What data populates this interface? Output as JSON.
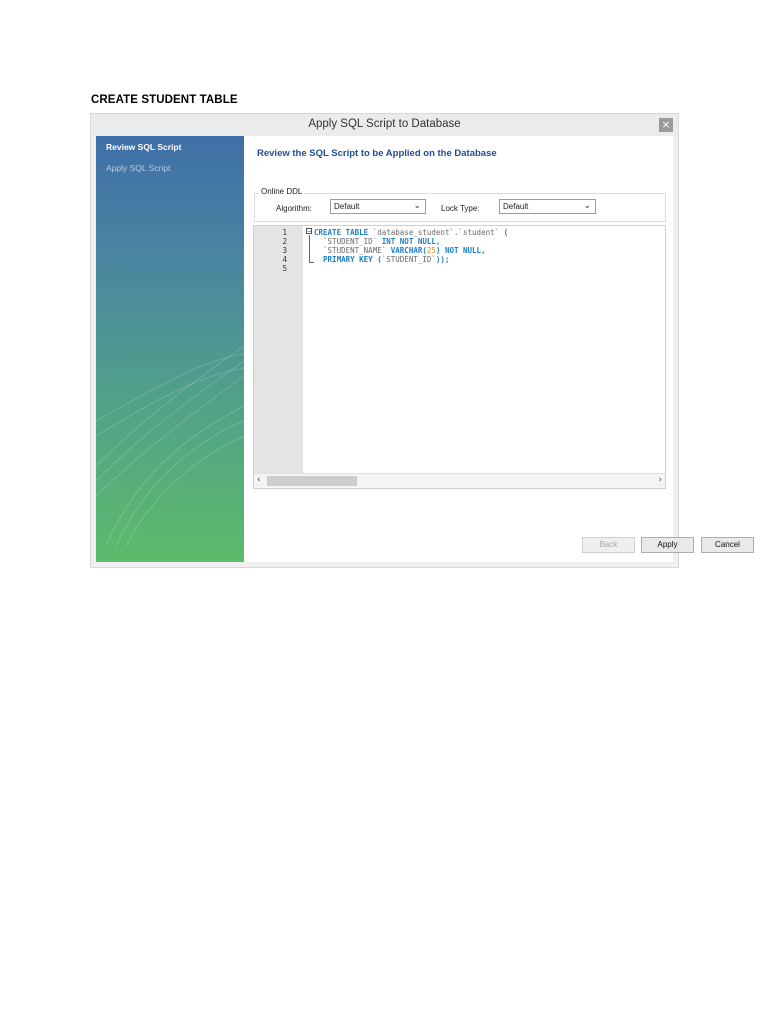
{
  "document": {
    "heading": "CREATE STUDENT TABLE"
  },
  "window": {
    "title": "Apply SQL Script to Database",
    "close_glyph": "×"
  },
  "sidebar": {
    "steps": [
      {
        "label": "Review SQL Script",
        "active": true
      },
      {
        "label": "Apply SQL Script",
        "active": false
      }
    ]
  },
  "main": {
    "heading": "Review the SQL Script to be Applied on the Database",
    "online_ddl": {
      "legend": "Online DDL",
      "algorithm_label": "Algorithm:",
      "algorithm_value": "Default",
      "lock_type_label": "Lock Type:",
      "lock_type_value": "Default"
    },
    "editor": {
      "line_numbers": [
        "1",
        "2",
        "3",
        "4",
        "5"
      ],
      "lines": [
        {
          "p1": "CREATE TABLE",
          "p2": " `database_student`.`student` ",
          "p3": "("
        },
        {
          "p1": "  `STUDENT_ID` ",
          "p2": "INT NOT NULL",
          "p3": ","
        },
        {
          "p1": "  `STUDENT_NAME` ",
          "p2": "VARCHAR(",
          "p3": "25",
          "p4": ") NOT NULL",
          "p5": ","
        },
        {
          "p1": "  PRIMARY KEY ",
          "p2": "(",
          "p3": "`STUDENT_ID`",
          "p4": "));"
        },
        {
          "p1": ""
        }
      ]
    }
  },
  "buttons": {
    "back": "Back",
    "apply": "Apply",
    "cancel": "Cancel"
  },
  "colors": {
    "accent_heading": "#1f4f93",
    "keyword": "#1e7fc4",
    "number": "#e08a1d"
  },
  "icons": {
    "close": "close-icon",
    "scroll_left": "chevron-left-icon",
    "scroll_right": "chevron-right-icon",
    "dropdown": "chevron-down-icon"
  }
}
